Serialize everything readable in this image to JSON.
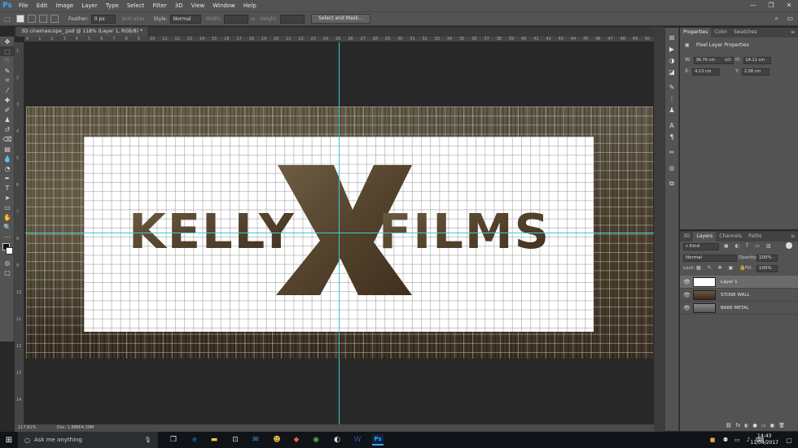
{
  "app": {
    "logo": "Ps"
  },
  "menu": [
    "File",
    "Edit",
    "Image",
    "Layer",
    "Type",
    "Select",
    "Filter",
    "3D",
    "View",
    "Window",
    "Help"
  ],
  "window_controls": [
    "—",
    "❐",
    "✕"
  ],
  "options": {
    "feather_label": "Feather:",
    "feather_value": "0 px",
    "antialias_label": "Anti-alias",
    "style_label": "Style:",
    "style_value": "Normal",
    "width_label": "Width:",
    "height_label": "Height:",
    "select_mask_label": "Select and Mask..."
  },
  "document": {
    "tab_title": "3D cinemascope_.psd @ 118% (Layer 1, RGB/8) *",
    "zoom": "117.81%",
    "doc_info": "Doc: 1.88M/4.39M"
  },
  "artwork": {
    "word1": "KELLY",
    "word2": "FILMS",
    "letter": "X"
  },
  "ruler_top_numbers": [
    "0",
    "1",
    "2",
    "3",
    "4",
    "5",
    "6",
    "7",
    "8",
    "9",
    "10",
    "11",
    "12",
    "13",
    "14",
    "15",
    "16",
    "17",
    "18",
    "19",
    "20",
    "21",
    "22",
    "23",
    "24",
    "25",
    "26",
    "27",
    "28",
    "29",
    "30",
    "31",
    "32",
    "33",
    "34",
    "35",
    "36",
    "37",
    "38",
    "39",
    "40",
    "41",
    "42",
    "43",
    "44",
    "45",
    "46",
    "47",
    "48",
    "49",
    "50"
  ],
  "ruler_left_numbers": [
    "1",
    "2",
    "3",
    "4",
    "5",
    "6",
    "7",
    "8",
    "9",
    "10",
    "11",
    "12",
    "13",
    "14"
  ],
  "properties": {
    "tabs": [
      "Properties",
      "Color",
      "Swatches"
    ],
    "subtitle": "Pixel Layer Properties",
    "w_label": "W:",
    "w_value": "36.76 cm",
    "h_label": "H:",
    "h_value": "14.11 cm",
    "x_label": "X:",
    "x_value": "4.13 cm",
    "y_label": "Y:",
    "y_value": "2.08 cm",
    "link_label": "GO"
  },
  "layers": {
    "tabs": [
      "3D",
      "Layers",
      "Channels",
      "Paths"
    ],
    "kind_label": "Kind",
    "blend_mode": "Normal",
    "opacity_label": "Opacity:",
    "opacity_value": "100%",
    "lock_label": "Lock:",
    "fill_label": "Fill:",
    "fill_value": "100%",
    "items": [
      {
        "name": "Layer 1",
        "selected": true
      },
      {
        "name": "STONE WALL",
        "selected": false
      },
      {
        "name": "BARE METAL",
        "selected": false
      }
    ],
    "footer_icons": [
      "⛓",
      "fx",
      "◐",
      "●",
      "▭",
      "▣",
      "🗑"
    ]
  },
  "taskbar": {
    "search_placeholder": "Ask me anything",
    "mic": "🎙",
    "time": "14:43",
    "date": "11/04/2017"
  },
  "colors": {
    "menu_bg": "#535353",
    "canvas_bg": "#282828",
    "guide": "#3fc9d9",
    "logo_text": "#5e4c35",
    "accent": "#31a8ff"
  }
}
